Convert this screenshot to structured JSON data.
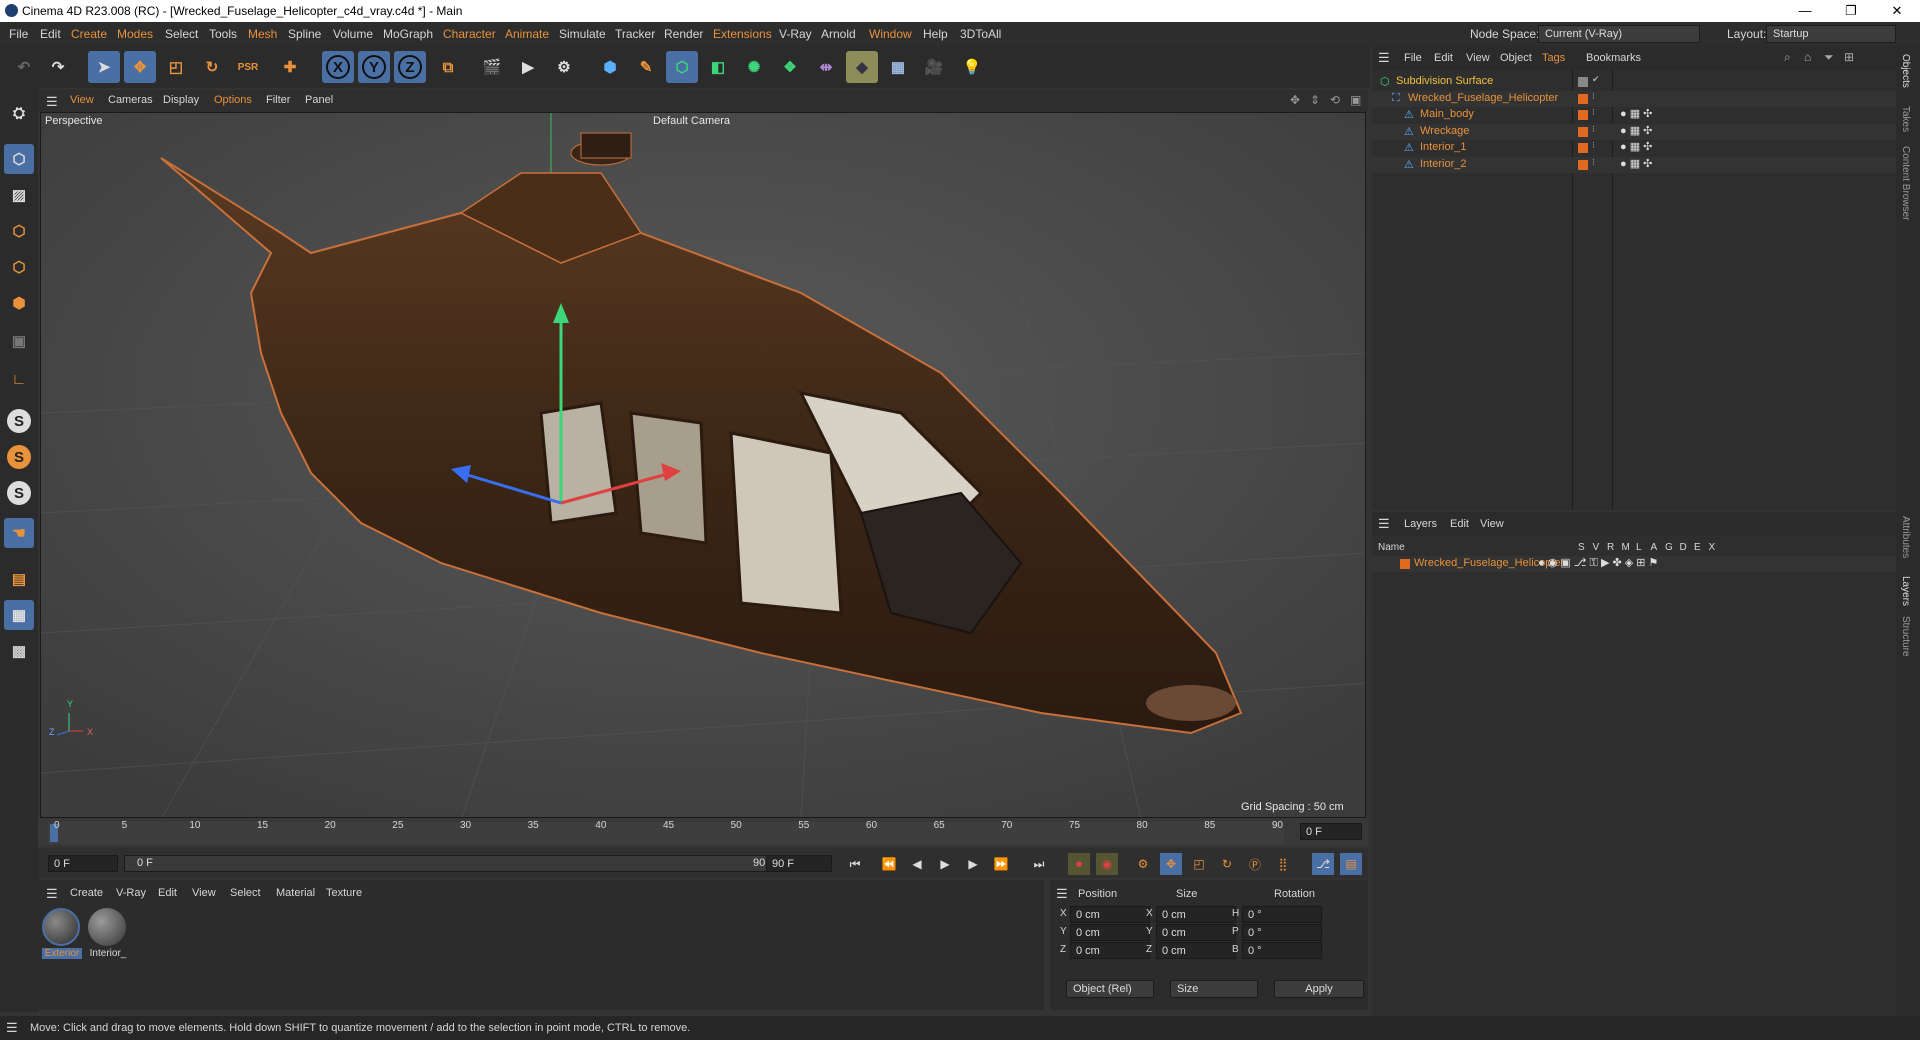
{
  "window": {
    "title": "Cinema 4D R23.008 (RC) - [Wrecked_Fuselage_Helicopter_c4d_vray.c4d *] - Main",
    "minimize": "—",
    "restore": "❐",
    "close": "✕"
  },
  "menu": {
    "items": [
      "File",
      "Edit",
      "Create",
      "Modes",
      "Select",
      "Tools",
      "Mesh",
      "Spline",
      "Volume",
      "MoGraph",
      "Character",
      "Animate",
      "Simulate",
      "Tracker",
      "Render",
      "Extensions",
      "V-Ray",
      "Arnold",
      "Window",
      "Help",
      "3DToAll"
    ],
    "node_space_label": "Node Space:",
    "node_space_value": "Current (V-Ray)",
    "layout_label": "Layout:",
    "layout_value": "Startup"
  },
  "toolbar": {
    "axis_x": "X",
    "axis_y": "Y",
    "axis_z": "Z"
  },
  "viewport": {
    "menu": [
      "View",
      "Cameras",
      "Display",
      "Options",
      "Filter",
      "Panel"
    ],
    "view_label": "Perspective",
    "camera_label": "Default Camera",
    "grid_spacing": "Grid Spacing : 50 cm",
    "axis_y": "Y",
    "axis_z": "Z",
    "axis_x": "X"
  },
  "timeline": {
    "ticks": [
      "0",
      "5",
      "10",
      "15",
      "20",
      "25",
      "30",
      "35",
      "40",
      "45",
      "50",
      "55",
      "60",
      "65",
      "70",
      "75",
      "80",
      "85",
      "90"
    ],
    "end_field": "0 F",
    "current_frame": "0 F",
    "range_start": "0 F",
    "range_end": "90 F",
    "max_frame": "90 F"
  },
  "materials": {
    "menu": [
      "Create",
      "V-Ray",
      "Edit",
      "View",
      "Select",
      "Material",
      "Texture"
    ],
    "items": [
      {
        "name": "Exterior"
      },
      {
        "name": "Interior_"
      }
    ]
  },
  "coordinates": {
    "headers": {
      "position": "Position",
      "size": "Size",
      "rotation": "Rotation"
    },
    "rows": [
      {
        "axis": "X",
        "pos": "0 cm",
        "saxis": "X",
        "size": "0 cm",
        "raxis": "H",
        "rot": "0 °"
      },
      {
        "axis": "Y",
        "pos": "0 cm",
        "saxis": "Y",
        "size": "0 cm",
        "raxis": "P",
        "rot": "0 °"
      },
      {
        "axis": "Z",
        "pos": "0 cm",
        "saxis": "Z",
        "size": "0 cm",
        "raxis": "B",
        "rot": "0 °"
      }
    ],
    "mode": "Object (Rel)",
    "size_mode": "Size",
    "apply": "Apply"
  },
  "status": "Move: Click and drag to move elements. Hold down SHIFT to quantize movement / add to the selection in point mode, CTRL to remove.",
  "object_manager": {
    "menu": [
      "File",
      "Edit",
      "View",
      "Object",
      "Tags",
      "Bookmarks"
    ],
    "objects": [
      {
        "name": "Subdivision Surface",
        "level": 0,
        "color": "#f0c040"
      },
      {
        "name": "Wrecked_Fuselage_Helicopter",
        "level": 1,
        "color": "#e8923c"
      },
      {
        "name": "Main_body",
        "level": 2,
        "color": "#e8923c"
      },
      {
        "name": "Wreckage",
        "level": 2,
        "color": "#e8923c"
      },
      {
        "name": "Interior_1",
        "level": 2,
        "color": "#e8923c"
      },
      {
        "name": "Interior_2",
        "level": 2,
        "color": "#e8923c"
      }
    ]
  },
  "layer_manager": {
    "menu": [
      "Layers",
      "Edit",
      "View"
    ],
    "name_header": "Name",
    "flags": [
      "S",
      "V",
      "R",
      "M",
      "L",
      "A",
      "G",
      "D",
      "E",
      "X"
    ],
    "layers": [
      {
        "name": "Wrecked_Fuselage_Helicopter",
        "color": "#e06a1f"
      }
    ]
  },
  "side_tabs": [
    "Objects",
    "Takes",
    "Content Browser",
    "Attributes",
    "Layers",
    "Structure"
  ],
  "colors": {
    "accent": "#e8923c",
    "selection": "#4a6fa5"
  }
}
